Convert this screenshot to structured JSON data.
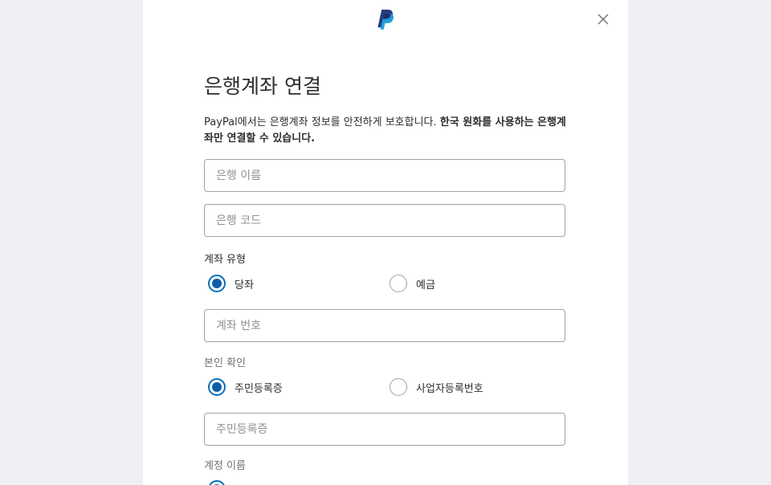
{
  "header": {
    "logo_icon": "paypal-logo-icon",
    "close_icon": "close-icon"
  },
  "form": {
    "title": "은행계좌 연결",
    "description_normal": "PayPal에서는 은행계좌 정보를 안전하게 보호합니다.",
    "description_bold": "한국 원화를 사용하는 은행계좌만 연결할 수 있습니다.",
    "bank_name_placeholder": "은행 이름",
    "bank_code_placeholder": "은행 코드",
    "account_type_label": "계좌 유형",
    "account_type_options": [
      {
        "label": "당좌",
        "selected": true
      },
      {
        "label": "예금",
        "selected": false
      }
    ],
    "account_number_placeholder": "계좌 번호",
    "identity_label": "본인 확인",
    "identity_options": [
      {
        "label": "주민등록증",
        "selected": true
      },
      {
        "label": "사업자등록번호",
        "selected": false
      }
    ],
    "resident_id_placeholder": "주민등록증",
    "account_name_label": "계정 이름"
  },
  "colors": {
    "accent": "#0070ba",
    "radio_fill": "#0b5fa8",
    "background": "#eef0f3",
    "border": "#9da3a6"
  }
}
